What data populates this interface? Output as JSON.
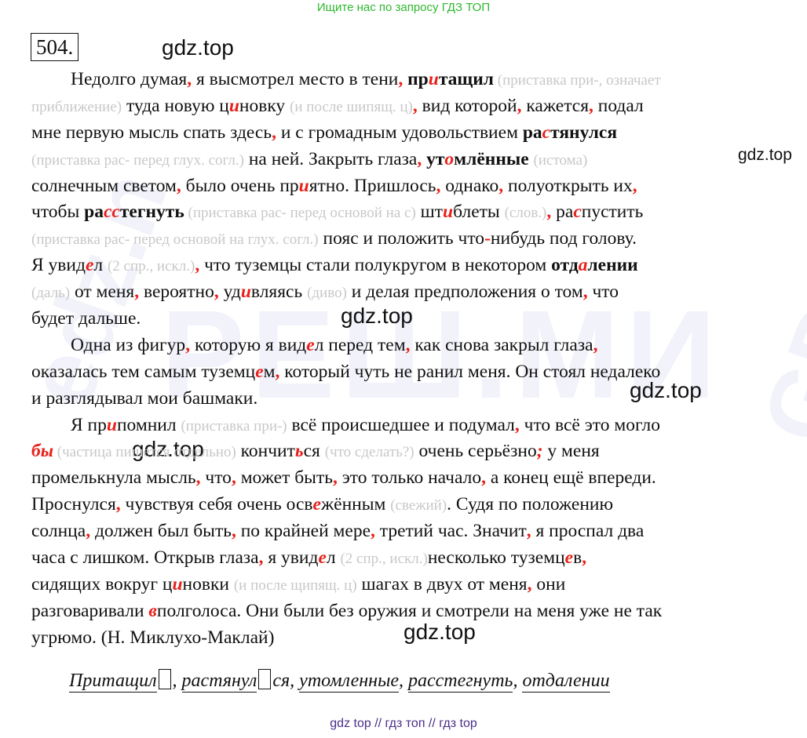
{
  "top_banner": "Ищите нас по запросу ГДЗ ТОП",
  "exercise_number": "504.",
  "watermark": "gdz.top",
  "bg_watermarks": [
    "РЕШ.МИ",
    "edz.n",
    "GDZ.n"
  ],
  "lines": [
    [
      [
        "Недолго думая",
        ""
      ],
      [
        ",",
        "r"
      ],
      [
        " я высмотрел место в тени",
        ""
      ],
      [
        ",",
        "r"
      ],
      [
        " ",
        ""
      ],
      [
        "пр",
        "b"
      ],
      [
        "и",
        "ri"
      ],
      [
        "тащил",
        "b"
      ],
      [
        " (приставка при-, означает",
        "g"
      ]
    ],
    [
      [
        "приближение)",
        "g"
      ],
      [
        " туда новую ц",
        ""
      ],
      [
        "и",
        "ri"
      ],
      [
        "новку ",
        ""
      ],
      [
        "(и после шипящ. ц)",
        "g"
      ],
      [
        ",",
        "r"
      ],
      [
        " вид которой",
        ""
      ],
      [
        ",",
        "r"
      ],
      [
        " кажется",
        ""
      ],
      [
        ",",
        "r"
      ],
      [
        " подал",
        ""
      ]
    ],
    [
      [
        "мне первую мысль спать здесь",
        ""
      ],
      [
        ",",
        "r"
      ],
      [
        " и с громадным удовольствием ",
        ""
      ],
      [
        "ра",
        "b"
      ],
      [
        "с",
        "ri"
      ],
      [
        "тянулся",
        "b"
      ]
    ],
    [
      [
        "(приставка рас- перед глух. согл.)",
        "g"
      ],
      [
        " на ней. Закрыть глаза",
        ""
      ],
      [
        ",",
        "r"
      ],
      [
        " ",
        ""
      ],
      [
        "ут",
        "b"
      ],
      [
        "о",
        "ri"
      ],
      [
        "млённые",
        "b"
      ],
      [
        " ",
        ""
      ],
      [
        "(истома)",
        "g"
      ]
    ],
    [
      [
        "солнечным светом",
        ""
      ],
      [
        ",",
        "r"
      ],
      [
        " было очень пр",
        ""
      ],
      [
        "и",
        "ri"
      ],
      [
        "ятно. Пришлось",
        ""
      ],
      [
        ",",
        "r"
      ],
      [
        " однако",
        ""
      ],
      [
        ",",
        "r"
      ],
      [
        " полуоткрыть их",
        ""
      ],
      [
        ",",
        "r"
      ]
    ],
    [
      [
        "чтобы ",
        ""
      ],
      [
        "ра",
        "b"
      ],
      [
        "сс",
        "ri"
      ],
      [
        "тегнуть",
        "b"
      ],
      [
        " (приставка рас- перед основой на с)",
        "g"
      ],
      [
        " шт",
        ""
      ],
      [
        "и",
        "ri"
      ],
      [
        "блеты ",
        ""
      ],
      [
        "(слов.)",
        "g"
      ],
      [
        ",",
        "r"
      ],
      [
        " ра",
        ""
      ],
      [
        "с",
        "ri"
      ],
      [
        "пустить",
        ""
      ]
    ],
    [
      [
        "(приставка рас- перед основой на глух. согл.)",
        "g"
      ],
      [
        " пояс и положить что",
        ""
      ],
      [
        "-",
        "r"
      ],
      [
        "нибудь под голову.",
        ""
      ]
    ],
    [
      [
        "Я увид",
        ""
      ],
      [
        "е",
        "ri"
      ],
      [
        "л ",
        ""
      ],
      [
        "(2 спр., искл.)",
        "g"
      ],
      [
        ",",
        "r"
      ],
      [
        " что туземцы стали полукругом в некотором ",
        ""
      ],
      [
        "отд",
        "b"
      ],
      [
        "а",
        "ri"
      ],
      [
        "лении",
        "b"
      ]
    ],
    [
      [
        "(даль)",
        "g"
      ],
      [
        " от меня",
        ""
      ],
      [
        ",",
        "r"
      ],
      [
        " вероятно",
        ""
      ],
      [
        ",",
        "r"
      ],
      [
        " уд",
        ""
      ],
      [
        "и",
        "ri"
      ],
      [
        "вляясь ",
        ""
      ],
      [
        "(диво)",
        "g"
      ],
      [
        " и делая предположения о том",
        ""
      ],
      [
        ",",
        "r"
      ],
      [
        " что",
        ""
      ]
    ],
    [
      [
        "будет дальше.",
        ""
      ]
    ],
    [
      [
        "Одна из фигур",
        ""
      ],
      [
        ",",
        "r"
      ],
      [
        " которую я вид",
        ""
      ],
      [
        "е",
        "ri"
      ],
      [
        "л перед тем",
        ""
      ],
      [
        ",",
        "r"
      ],
      [
        " как снова закрыл глаза",
        ""
      ],
      [
        ",",
        "r"
      ]
    ],
    [
      [
        "оказалась тем самым туземц",
        ""
      ],
      [
        "е",
        "ri"
      ],
      [
        "м",
        ""
      ],
      [
        ",",
        "r"
      ],
      [
        " который чуть не ранил меня. Он стоял недалеко",
        ""
      ]
    ],
    [
      [
        "и разглядывал мои башмаки.",
        ""
      ]
    ],
    [
      [
        "Я пр",
        ""
      ],
      [
        "и",
        "ri"
      ],
      [
        "помнил ",
        ""
      ],
      [
        "(приставка при-)",
        "g"
      ],
      [
        " всё происшедшее и подумал",
        ""
      ],
      [
        ",",
        "r"
      ],
      [
        " что всё это могло",
        ""
      ]
    ],
    [
      [
        "бы",
        "ri"
      ],
      [
        " (частица ",
        "g"
      ],
      [
        "пишется",
        "g"
      ],
      [
        " отдельно)",
        "g"
      ],
      [
        " кончит",
        ""
      ],
      [
        "ь",
        "ri"
      ],
      [
        "ся ",
        ""
      ],
      [
        "(что сделать?)",
        "g"
      ],
      [
        " очень серьёзно",
        ""
      ],
      [
        ";",
        "ri"
      ],
      [
        " у меня",
        ""
      ]
    ],
    [
      [
        "промелькнула мысль",
        ""
      ],
      [
        ",",
        "r"
      ],
      [
        " что",
        ""
      ],
      [
        ",",
        "r"
      ],
      [
        " может быть",
        ""
      ],
      [
        ",",
        "r"
      ],
      [
        " это только начало",
        ""
      ],
      [
        ",",
        "r"
      ],
      [
        " а конец ещё впереди.",
        ""
      ]
    ],
    [
      [
        "Проснулся",
        ""
      ],
      [
        ",",
        "r"
      ],
      [
        " чувствуя себя очень осв",
        ""
      ],
      [
        "е",
        "ri"
      ],
      [
        "жённым ",
        ""
      ],
      [
        "(свежий)",
        "g"
      ],
      [
        ". Судя по положению",
        ""
      ]
    ],
    [
      [
        "солнца",
        ""
      ],
      [
        ",",
        "r"
      ],
      [
        " должен был быть",
        ""
      ],
      [
        ",",
        "r"
      ],
      [
        " по крайней мере",
        ""
      ],
      [
        ",",
        "r"
      ],
      [
        " третий час. Значит",
        ""
      ],
      [
        ",",
        "r"
      ],
      [
        " я проспал два",
        ""
      ]
    ],
    [
      [
        "часа с лишком. Открыв глаза",
        ""
      ],
      [
        ",",
        "r"
      ],
      [
        " я увид",
        ""
      ],
      [
        "е",
        "ri"
      ],
      [
        "л ",
        ""
      ],
      [
        "(2 спр., искл.)",
        "g"
      ],
      [
        "несколько туземц",
        ""
      ],
      [
        "е",
        "ri"
      ],
      [
        "в",
        ""
      ],
      [
        ",",
        "r"
      ]
    ],
    [
      [
        "сидящих вокруг ц",
        ""
      ],
      [
        "и",
        "ri"
      ],
      [
        "новки ",
        ""
      ],
      [
        "(и после щипящ. ц)",
        "g"
      ],
      [
        " шагах в двух от меня",
        ""
      ],
      [
        ",",
        "r"
      ],
      [
        " они",
        ""
      ]
    ],
    [
      [
        "разговаривали ",
        ""
      ],
      [
        "в",
        "ri"
      ],
      [
        "полголоса. Они были без оружия и смотрели на меня уже не так",
        ""
      ]
    ],
    [
      [
        "угрюмо. (Н. Миклухо-Маклай)",
        ""
      ]
    ]
  ],
  "morphemes": [
    "Притащил",
    ", ",
    "растянул",
    "ся",
    ", ",
    "утомленные",
    ", ",
    "расстегнуть",
    ", ",
    "отдалении"
  ],
  "footer": "gdz top  //  гдз топ  //  гдз top"
}
